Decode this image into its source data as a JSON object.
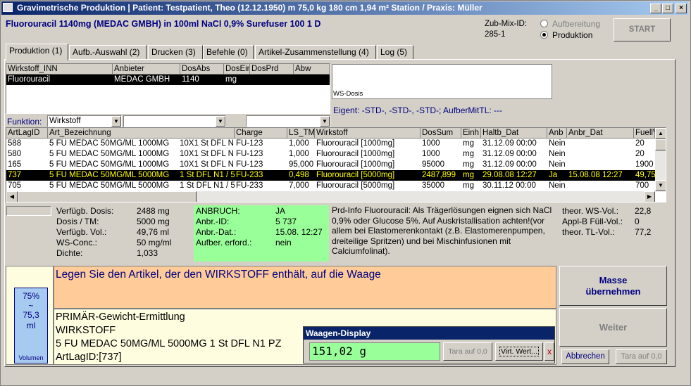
{
  "window": {
    "title": "Gravimetrische Produktion  |  Patient: Testpatient, Theo (12.12.1950) m 75,0 kg  180 cm  1,94 m² Station / Praxis: Müller"
  },
  "header": {
    "product": "Fluorouracil 1140mg (MEDAC GMBH) in 100ml NaCl 0,9% Surefuser 100 1 D",
    "mix_label": "Zub-Mix-ID:",
    "mix_id": "285-1",
    "radio_aufbereitung": "Aufbereitung",
    "radio_produktion": "Produktion",
    "start": "START"
  },
  "tabs": [
    "Produktion (1)",
    "Aufb.-Auswahl (2)",
    "Drucken (3)",
    "Befehle (0)",
    "Artikel-Zusammenstellung (4)",
    "Log (5)"
  ],
  "wirkstoff_table": {
    "headers": [
      "Wirkstoff_INN",
      "Anbieter",
      "DosAbs",
      "DosEinh",
      "DosPrd",
      "Abw"
    ],
    "row": [
      "Fluorouracil",
      "MEDAC GMBH",
      "1140",
      "mg",
      "",
      ""
    ]
  },
  "ws_dosis_label": "WS-Dosis",
  "eigent": "Eigent: -STD-, -STD-, -STD-; AufberMitTL: ---",
  "funktion_label": "Funktion:",
  "funktion_value": "Wirkstoff",
  "article_table": {
    "headers": [
      "ArtLagID",
      "Art_Bezeichnung",
      "Charge",
      "LS_TM",
      "Wirkstoff",
      "DosSum",
      "Einh",
      "Haltb_Dat",
      "Anb",
      "Anbr_Dat",
      "FuellV"
    ],
    "rows": [
      [
        "588",
        "5 FU MEDAC 50MG/ML 1000MG",
        "10X1 St DFL N",
        "FU-123",
        "1,000",
        "Fluorouracil [1000mg]",
        "1000",
        "mg",
        "31.12.09 00:00",
        "Nein",
        "",
        "20"
      ],
      [
        "580",
        "5 FU MEDAC 50MG/ML 1000MG",
        "10X1 St DFL N",
        "FU-123",
        "1,000",
        "Fluorouracil [1000mg]",
        "1000",
        "mg",
        "31.12.09 00:00",
        "Nein",
        "",
        "20"
      ],
      [
        "165",
        "5 FU MEDAC 50MG/ML 1000MG",
        "10X1 St DFL N",
        "FU-123",
        "95,000",
        "Fluorouracil [1000mg]",
        "95000",
        "mg",
        "31.12.09 00:00",
        "Nein",
        "",
        "1900"
      ],
      [
        "737",
        "5 FU MEDAC 50MG/ML 5000MG",
        "1 St DFL N1 / 5",
        "FU-233",
        "0,498",
        "Fluorouracil [5000mg]",
        "2487,899",
        "mg",
        "29.08.08 12:27",
        "Ja",
        "15.08.08 12:27",
        "49,75"
      ],
      [
        "705",
        "5 FU MEDAC 50MG/ML 5000MG",
        "1 St DFL N1 / 5",
        "FU-233",
        "7,000",
        "Fluorouracil [5000mg]",
        "35000",
        "mg",
        "30.11.12 00:00",
        "Nein",
        "",
        "700"
      ]
    ]
  },
  "info": {
    "labels": [
      "Verfügb. Dosis:",
      "Dosis / TM:",
      "Verfügb. Vol.:",
      "WS-Conc.:",
      "Dichte:"
    ],
    "values": [
      "2488 mg",
      "5000 mg",
      "49,76 ml",
      "50 mg/ml",
      "1,033"
    ]
  },
  "anbruch": {
    "labels": [
      "ANBRUCH:",
      "Anbr.-ID:",
      "Anbr.-Dat.:",
      "Aufber. erford.:"
    ],
    "values": [
      "JA",
      "5 737",
      "15.08. 12:27",
      "nein"
    ]
  },
  "prdinfo": "Prd-Info Fluorouracil: Als Trägerlösungen eignen sich NaCl 0,9% oder Glucose 5%. Auf Auskristallisation achten!(vor allem bei Elastomerenkontakt (z.B. Elastomerenpumpen, dreiteilige Spritzen) und bei Mischinfusionen mit Calciumfolinat).",
  "theor": {
    "labels": [
      "theor. WS-Vol.:",
      "Appl-B Füll-Vol.:",
      "theor. TL-Vol.:"
    ],
    "values": [
      "22,8",
      "0",
      "77,2"
    ]
  },
  "volumen": {
    "pct": "75%",
    "tilde": "~",
    "ml": "75,3",
    "unit": "ml",
    "label": "Volumen"
  },
  "instruction": "Legen Sie den Artikel, der den WIRKSTOFF enthält, auf die Waage",
  "details": [
    "PRIMÄR-Gewicht-Ermittlung",
    "WIRKSTOFF",
    "5 FU MEDAC 50MG/ML 5000MG    1 St DFL N1 PZ",
    "ArtLagID:[737]"
  ],
  "waage": {
    "title": "Waagen-Display",
    "value": "151,02 g",
    "tara": "Tara auf 0,0",
    "virt": "Virt. Wert...",
    "close": "x"
  },
  "buttons": {
    "masse": "Masse übernehmen",
    "weiter": "Weiter",
    "abbrechen": "Abbrechen",
    "tara": "Tara auf 0,0"
  }
}
